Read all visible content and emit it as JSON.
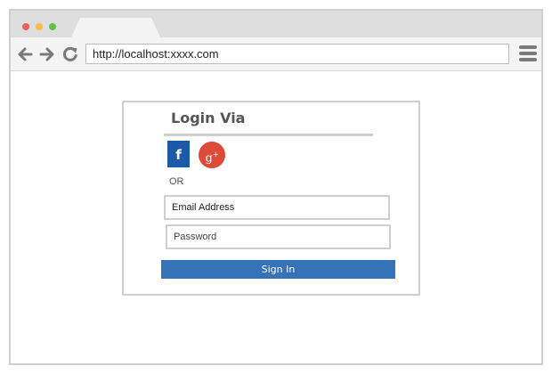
{
  "browser": {
    "url": "http://localhost:xxxx.com"
  },
  "login": {
    "title": "Login Via",
    "facebook_glyph": "f",
    "google_glyph": "g",
    "google_plus": "+",
    "or_label": "OR",
    "email_placeholder": "Email Address",
    "password_placeholder": "Password",
    "signin_label": "Sign In"
  },
  "colors": {
    "facebook": "#1c5aa6",
    "google_plus": "#dd4a38",
    "primary_button": "#3572b8",
    "window_close": "#ee5f5b",
    "window_minimize": "#f5c044",
    "window_maximize": "#5fc04a"
  },
  "icons": [
    "back-arrow-icon",
    "forward-arrow-icon",
    "reload-icon",
    "hamburger-menu-icon",
    "facebook-icon",
    "google-plus-icon"
  ]
}
